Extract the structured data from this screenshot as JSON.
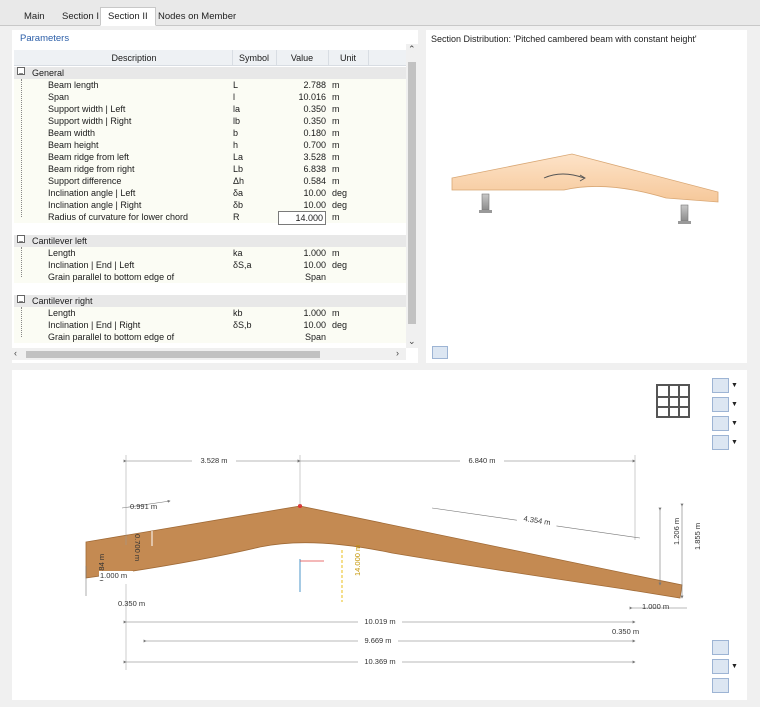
{
  "tabs": [
    "Main",
    "Section I",
    "Section II",
    "Nodes on Member"
  ],
  "active_tab": "Section II",
  "parameters": {
    "title": "Parameters",
    "columns": {
      "description": "Description",
      "symbol": "Symbol",
      "value": "Value",
      "unit": "Unit"
    },
    "groups": [
      {
        "label": "General",
        "rows": [
          {
            "description": "Beam length",
            "symbol": "L",
            "value": "2.788",
            "unit": "m"
          },
          {
            "description": "Span",
            "symbol": "l",
            "value": "10.016",
            "unit": "m"
          },
          {
            "description": "Support width | Left",
            "symbol": "la",
            "value": "0.350",
            "unit": "m"
          },
          {
            "description": "Support width | Right",
            "symbol": "lb",
            "value": "0.350",
            "unit": "m"
          },
          {
            "description": "Beam width",
            "symbol": "b",
            "value": "0.180",
            "unit": "m"
          },
          {
            "description": "Beam height",
            "symbol": "h",
            "value": "0.700",
            "unit": "m"
          },
          {
            "description": "Beam ridge from left",
            "symbol": "La",
            "value": "3.528",
            "unit": "m"
          },
          {
            "description": "Beam ridge from right",
            "symbol": "Lb",
            "value": "6.838",
            "unit": "m"
          },
          {
            "description": "Support difference",
            "symbol": "Δh",
            "value": "0.584",
            "unit": "m"
          },
          {
            "description": "Inclination angle | Left",
            "symbol": "δa",
            "value": "10.00",
            "unit": "deg"
          },
          {
            "description": "Inclination angle | Right",
            "symbol": "δb",
            "value": "10.00",
            "unit": "deg"
          },
          {
            "description": "Radius of curvature for lower chord",
            "symbol": "R",
            "value": "14.000",
            "unit": "m"
          }
        ]
      },
      {
        "label": "Cantilever left",
        "rows": [
          {
            "description": "Length",
            "symbol": "ka",
            "value": "1.000",
            "unit": "m"
          },
          {
            "description": "Inclination | End | Left",
            "symbol": "δS,a",
            "value": "10.00",
            "unit": "deg"
          },
          {
            "description": "Grain parallel to bottom edge of",
            "symbol": "",
            "value": "Span",
            "unit": ""
          }
        ]
      },
      {
        "label": "Cantilever right",
        "rows": [
          {
            "description": "Length",
            "symbol": "kb",
            "value": "1.000",
            "unit": "m"
          },
          {
            "description": "Inclination | End | Right",
            "symbol": "δS,b",
            "value": "10.00",
            "unit": "deg"
          },
          {
            "description": "Grain parallel to bottom edge of",
            "symbol": "",
            "value": "Span",
            "unit": ""
          }
        ]
      }
    ]
  },
  "section_distribution": {
    "title": "Section Distribution: 'Pitched cambered beam with constant height'"
  },
  "dimensions": {
    "ridge_left": "3.528 m",
    "ridge_right": "6.840 m",
    "cantilever_top_left": "0.991 m",
    "height": "0.700 m",
    "slope_right": "4.354 m",
    "right_rise": "1.206 m",
    "right_total": "1.855 m",
    "left_rise": "0.584 m",
    "cantilever_left": "1.000 m",
    "radius": "14.000 m",
    "support_left": "0.350 m",
    "cantilever_right": "1.000 m",
    "span_a": "10.019 m",
    "support_right": "0.350 m",
    "span_b": "9.669 m",
    "span_total": "10.369 m"
  },
  "colors": {
    "beam_bottom": "#c9894e",
    "beam_top": "#f9d7b4",
    "link": "#2b5ea8"
  }
}
